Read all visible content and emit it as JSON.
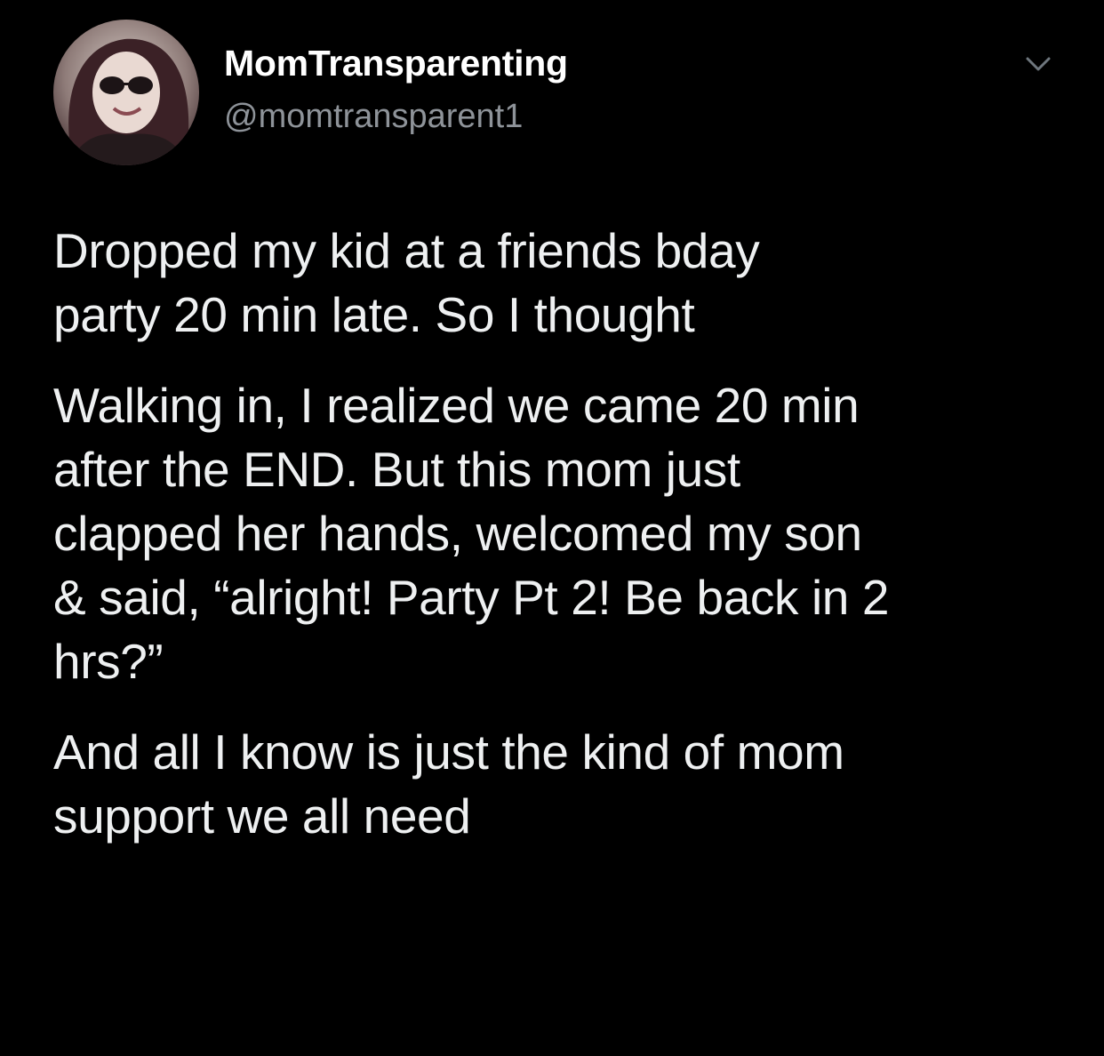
{
  "tweet": {
    "author": {
      "display_name": "MomTransparenting",
      "handle": "@momtransparent1",
      "avatar_icon": "profile-photo"
    },
    "menu_icon": "chevron-down-icon",
    "paragraphs": [
      "Dropped my kid at a friends bday\nparty 20 min late. So I thought",
      "Walking in, I realized we came 20 min\nafter the END. But this mom just\nclapped her hands, welcomed my son\n& said, “alright! Party Pt 2! Be back in 2\nhrs?”",
      "And all I know is just the kind of mom\nsupport we all need"
    ]
  },
  "colors": {
    "background": "#000000",
    "name_text": "#ffffff",
    "body_text": "#eef0f1",
    "handle_text": "#8e9399",
    "chevron": "#6e767d"
  }
}
